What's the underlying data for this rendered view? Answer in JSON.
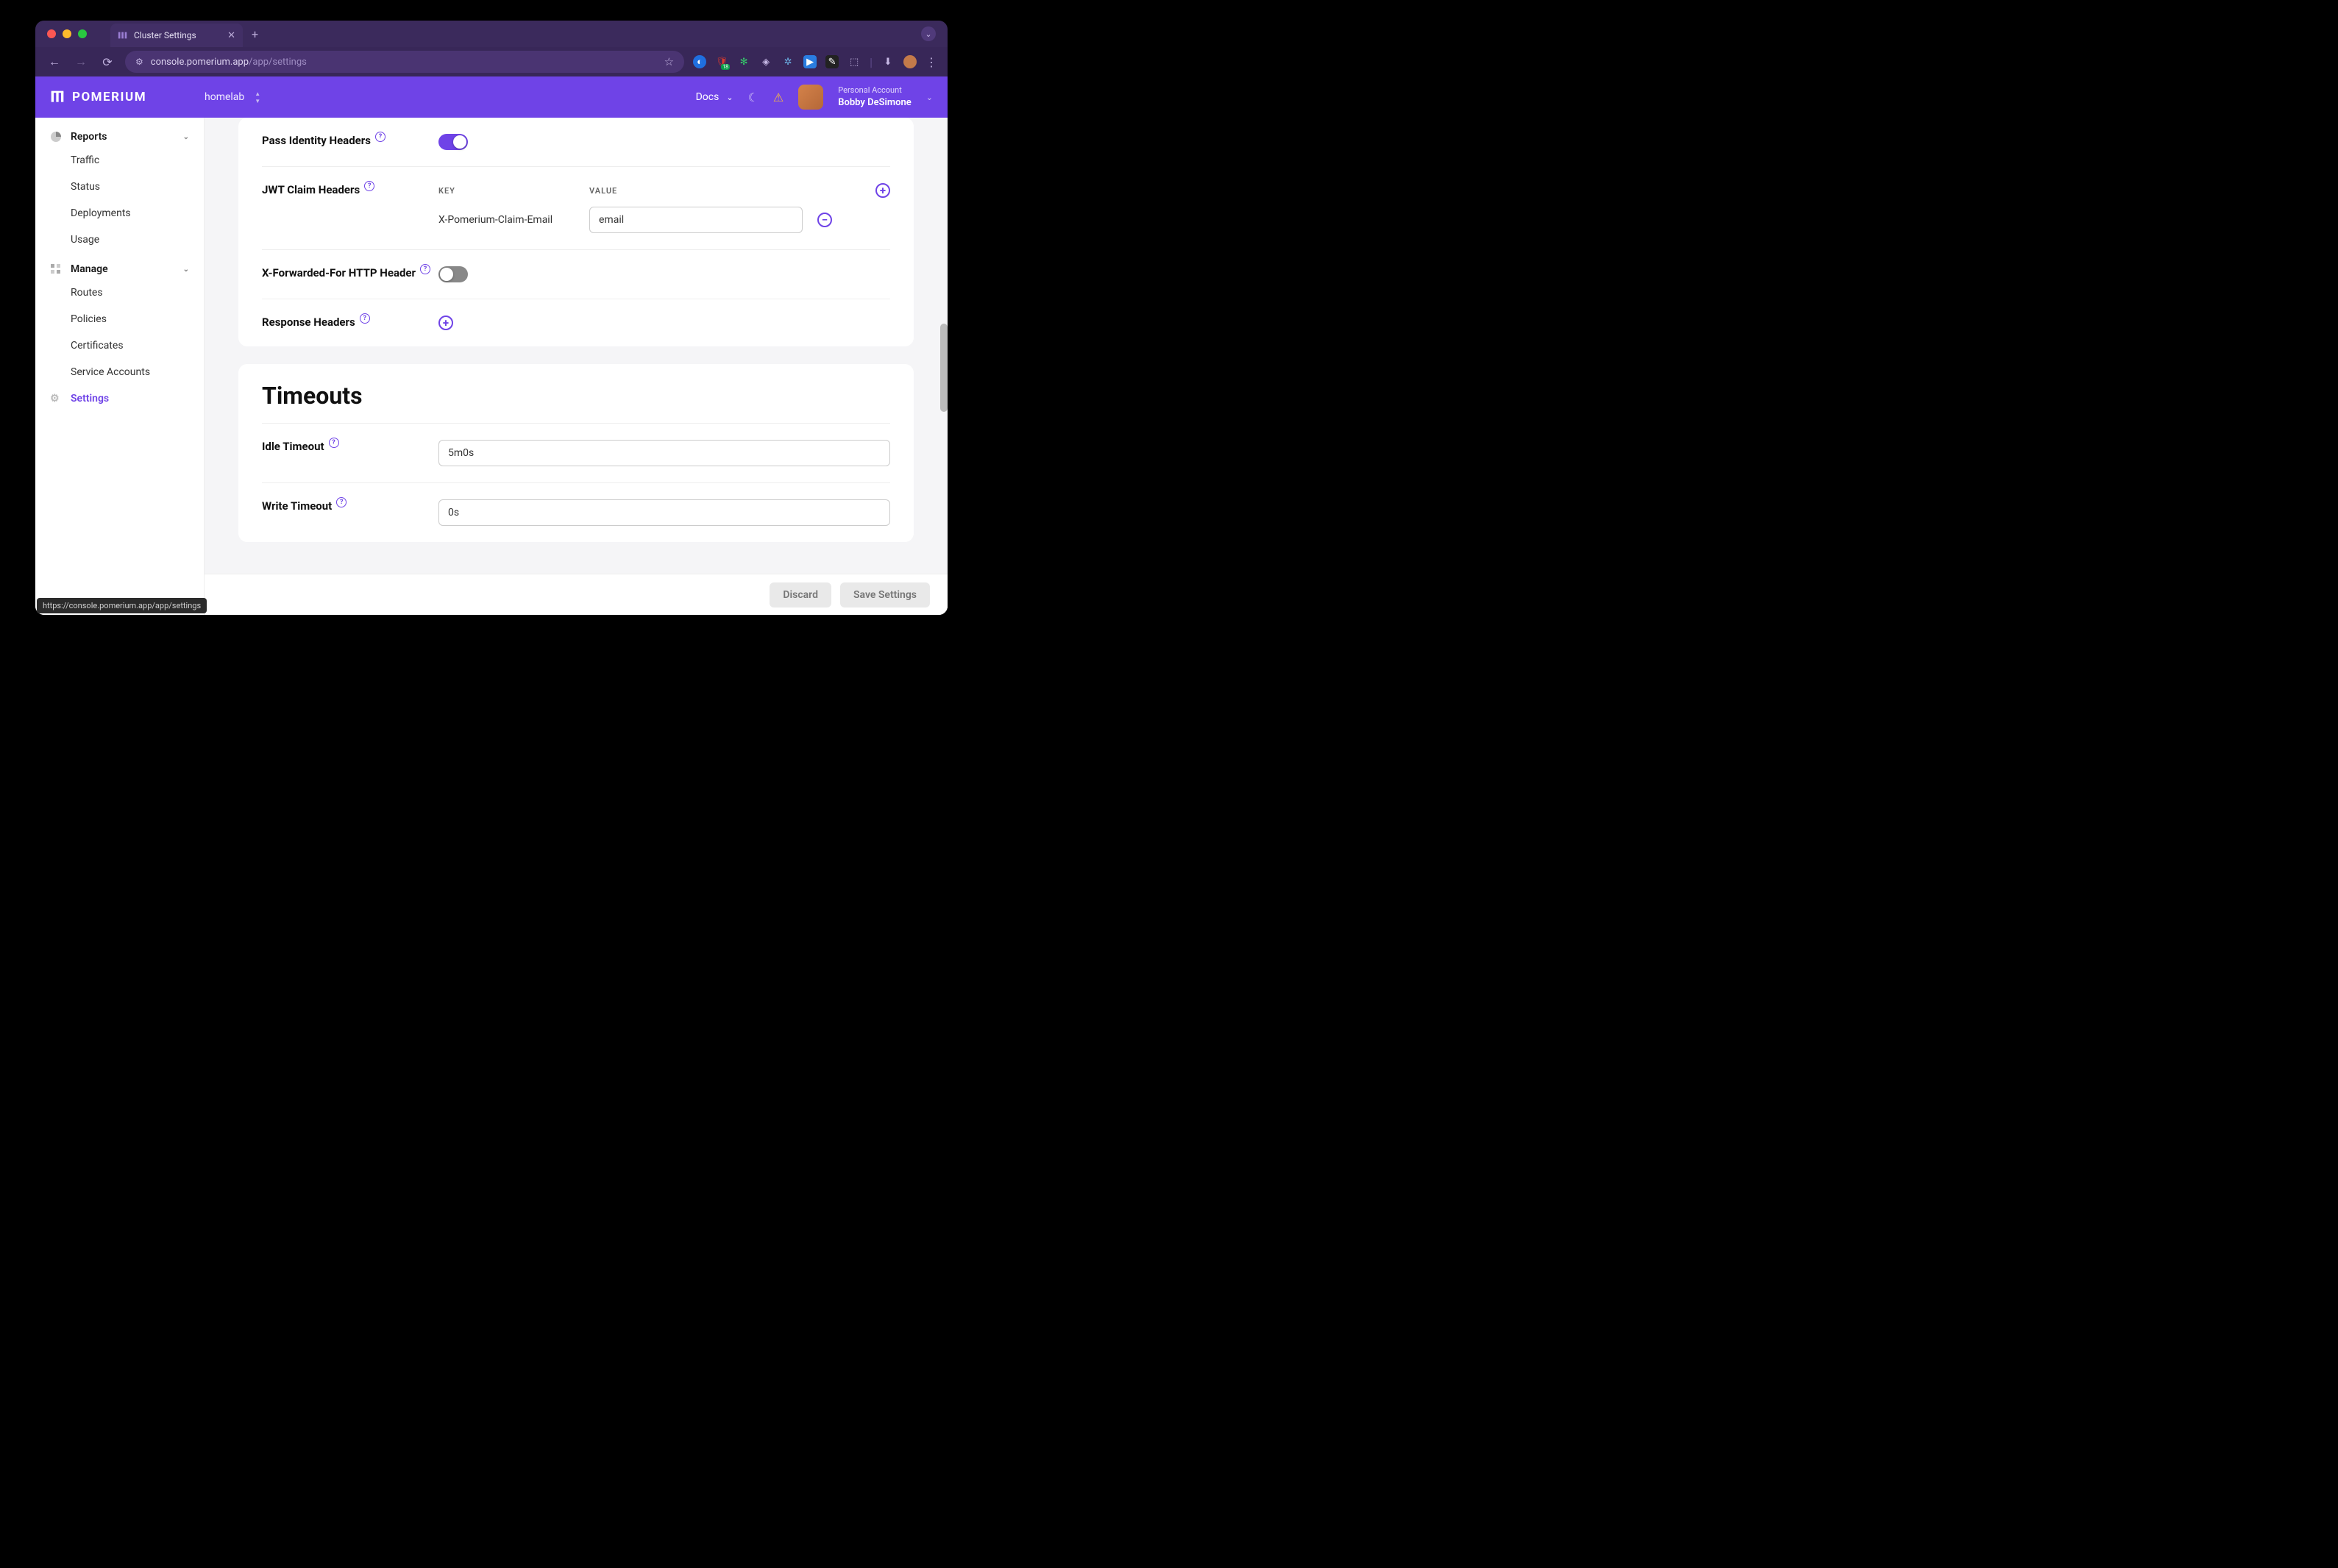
{
  "browser": {
    "tab_title": "Cluster Settings",
    "url_host": "console.pomerium.app",
    "url_path": "/app/settings",
    "status_url": "https://console.pomerium.app/app/settings",
    "ext_badge": "18"
  },
  "header": {
    "brand": "POMERIUM",
    "namespace": "homelab",
    "docs": "Docs",
    "account_line1": "Personal Account",
    "account_line2": "Bobby DeSimone"
  },
  "sidebar": {
    "reports": {
      "label": "Reports",
      "items": [
        "Traffic",
        "Status",
        "Deployments",
        "Usage"
      ]
    },
    "manage": {
      "label": "Manage",
      "items": [
        "Routes",
        "Policies",
        "Certificates",
        "Service Accounts",
        "Settings"
      ],
      "active": "Settings"
    }
  },
  "settings": {
    "pass_identity_label": "Pass Identity Headers",
    "pass_identity_on": true,
    "jwt_label": "JWT Claim Headers",
    "jwt_key_col": "KEY",
    "jwt_val_col": "VALUE",
    "jwt_row_key": "X-Pomerium-Claim-Email",
    "jwt_row_val": "email",
    "xff_label": "X-Forwarded-For HTTP Header",
    "xff_on": false,
    "resp_label": "Response Headers"
  },
  "timeouts": {
    "title": "Timeouts",
    "idle_label": "Idle Timeout",
    "idle_value": "5m0s",
    "write_label": "Write Timeout",
    "write_value": "0s"
  },
  "footer": {
    "discard": "Discard",
    "save": "Save Settings"
  }
}
